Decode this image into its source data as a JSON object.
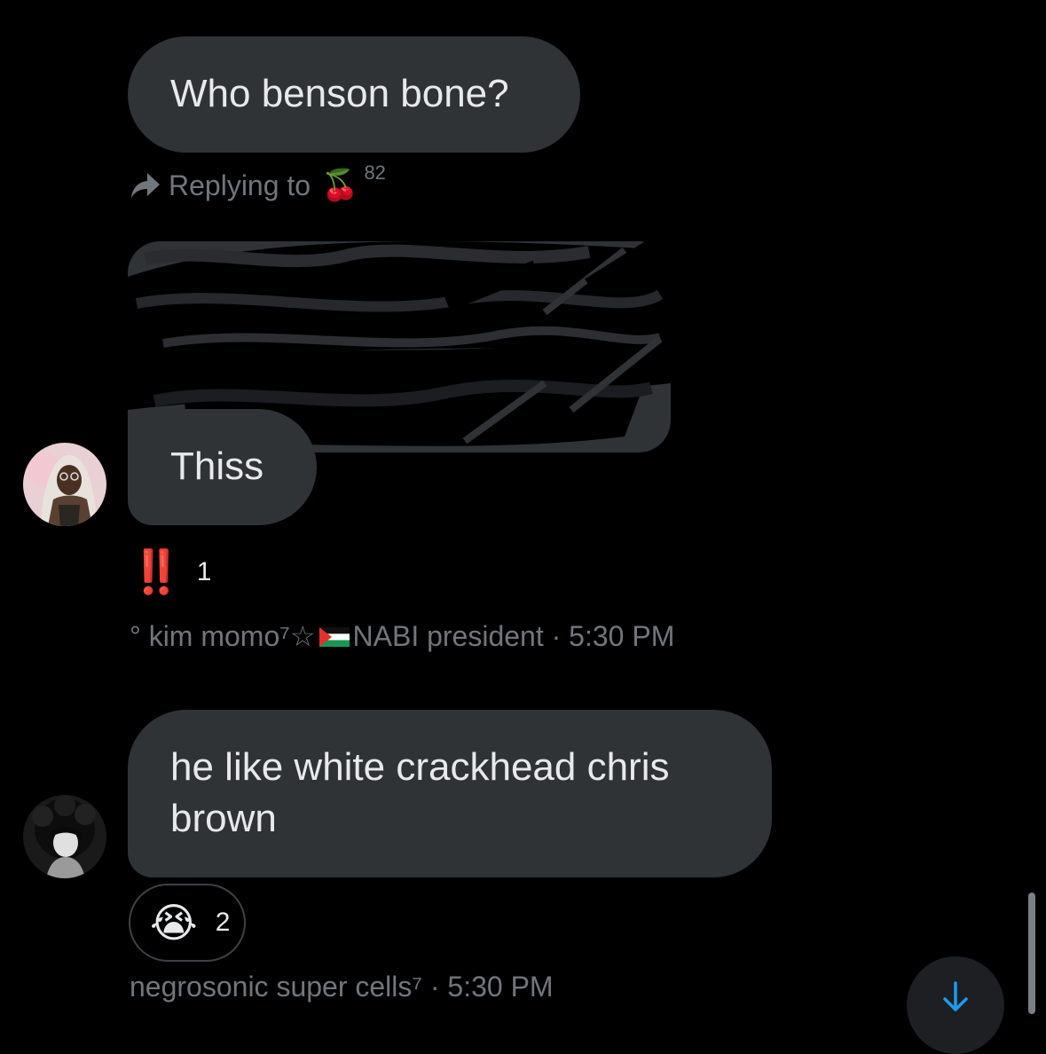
{
  "messages": [
    {
      "text": "Who benson bone?"
    },
    {
      "reply_label": "Replying to",
      "reply_emoji": "🍒",
      "reply_count": "82"
    },
    {
      "text": "Thiss",
      "reaction_emoji": "‼️",
      "reaction_count": "1",
      "sender": "° kim momo⁷☆",
      "sender_suffix": "NABI president",
      "time": "· 5:30 PM"
    },
    {
      "text": "he like white crackhead chris brown",
      "reaction_emoji": "😭",
      "reaction_count": "2",
      "sender": "negrosonic super cells⁷",
      "time": "· 5:30 PM"
    }
  ],
  "icons": {
    "reply": "reply-arrow-icon",
    "scroll_down": "arrow-down-icon",
    "flag": "palestine-flag-icon"
  },
  "colors": {
    "background": "#000000",
    "bubble": "#2f3336",
    "secondary_text": "#71767b",
    "accent": "#1d9bf0"
  }
}
